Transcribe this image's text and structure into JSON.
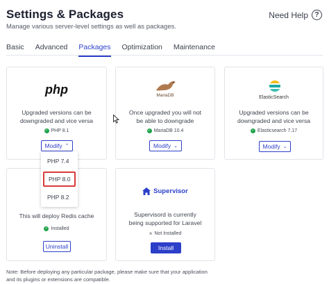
{
  "header": {
    "title": "Settings & Packages",
    "subtitle": "Manage various server-level settings as well as packages.",
    "help_label": "Need Help",
    "help_icon": "question-circle-icon"
  },
  "tabs": [
    {
      "label": "Basic",
      "active": false
    },
    {
      "label": "Advanced",
      "active": false
    },
    {
      "label": "Packages",
      "active": true
    },
    {
      "label": "Optimization",
      "active": false
    },
    {
      "label": "Maintenance",
      "active": false
    }
  ],
  "packages": {
    "php": {
      "logo_text": "php",
      "description_line1": "Upgraded versions can be",
      "description_line2": "downgraded and vice versa",
      "status": "PHP 8.1",
      "button": "Modify",
      "dropdown_open": true
    },
    "mariadb": {
      "logo_text": "MariaDB",
      "description_line1": "Once upgraded you will not",
      "description_line2": "be able to downgrade",
      "status": "MariaDB 10.4",
      "button": "Modify"
    },
    "elasticsearch": {
      "logo_text": "ElasticSearch",
      "description_line1": "Upgraded versions can be",
      "description_line2": "downgraded and vice versa",
      "status": "Elasticsearch 7.17",
      "button": "Modify"
    },
    "redis": {
      "description_line1": "This will deploy Redis cache",
      "status": "Installed",
      "button": "Uninstall"
    },
    "supervisor": {
      "logo_text": "Supervisor",
      "description_line1": "Supervisord is currently",
      "description_line2": "being supported for Laravel",
      "status": "Not Installed",
      "button": "Install"
    }
  },
  "php_dropdown": {
    "options": [
      "PHP 7.4",
      "PHP 8.0",
      "PHP 8.2"
    ],
    "highlighted": "PHP 8.0"
  },
  "footnote": {
    "line1": "Note: Before deploying any particular package, please make sure that your application",
    "line2": "and its plugins or extensions are compatible."
  },
  "colors": {
    "accent": "#2b3fc9",
    "success": "#1fa34a",
    "highlight_border": "#d93a3a"
  }
}
